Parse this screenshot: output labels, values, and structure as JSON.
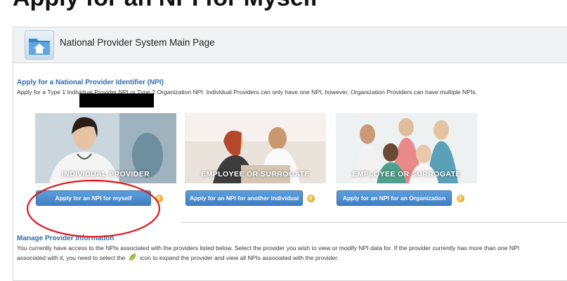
{
  "top": {
    "heading": "Apply for an NPI for Myself"
  },
  "header": {
    "title": "National Provider System Main Page"
  },
  "apply_section": {
    "title": "Apply for a National Provider Identifier (NPI)",
    "desc_a": "Apply for a Type ",
    "desc_b": "1 Individual Provider NPI or Type 2 Organization NPI. Individual Providers can only have one NPI, however, Organization Providers can have multiple NPIs."
  },
  "cards": [
    {
      "caption": "INDIVIDUAL PROVIDER",
      "button": "Apply for an NPI for myself"
    },
    {
      "caption": "EMPLOYEE OR SURROGATE",
      "button": "Apply for an NPI for another Individual"
    },
    {
      "caption": "EMPLOYEE OR SURROGATE",
      "button": "Apply for an NPI for an Organization"
    }
  ],
  "info_symbol": "i",
  "manage": {
    "title": "Manage Provider Information",
    "line1": "You currently have access to the NPIs associated with the providers listed below. Select the provider you wish to view or modify NPI data for. If the provider currently has more than one NPI",
    "line2_a": "associated with it, you need to select the",
    "line2_b": "icon to expand the provider and view all NPIs associated with the provider."
  },
  "colors": {
    "link_blue": "#2b6db0",
    "button_blue": "#4a8ccf",
    "annotation_red": "#e0151b",
    "info_orange": "#f0a71e"
  }
}
